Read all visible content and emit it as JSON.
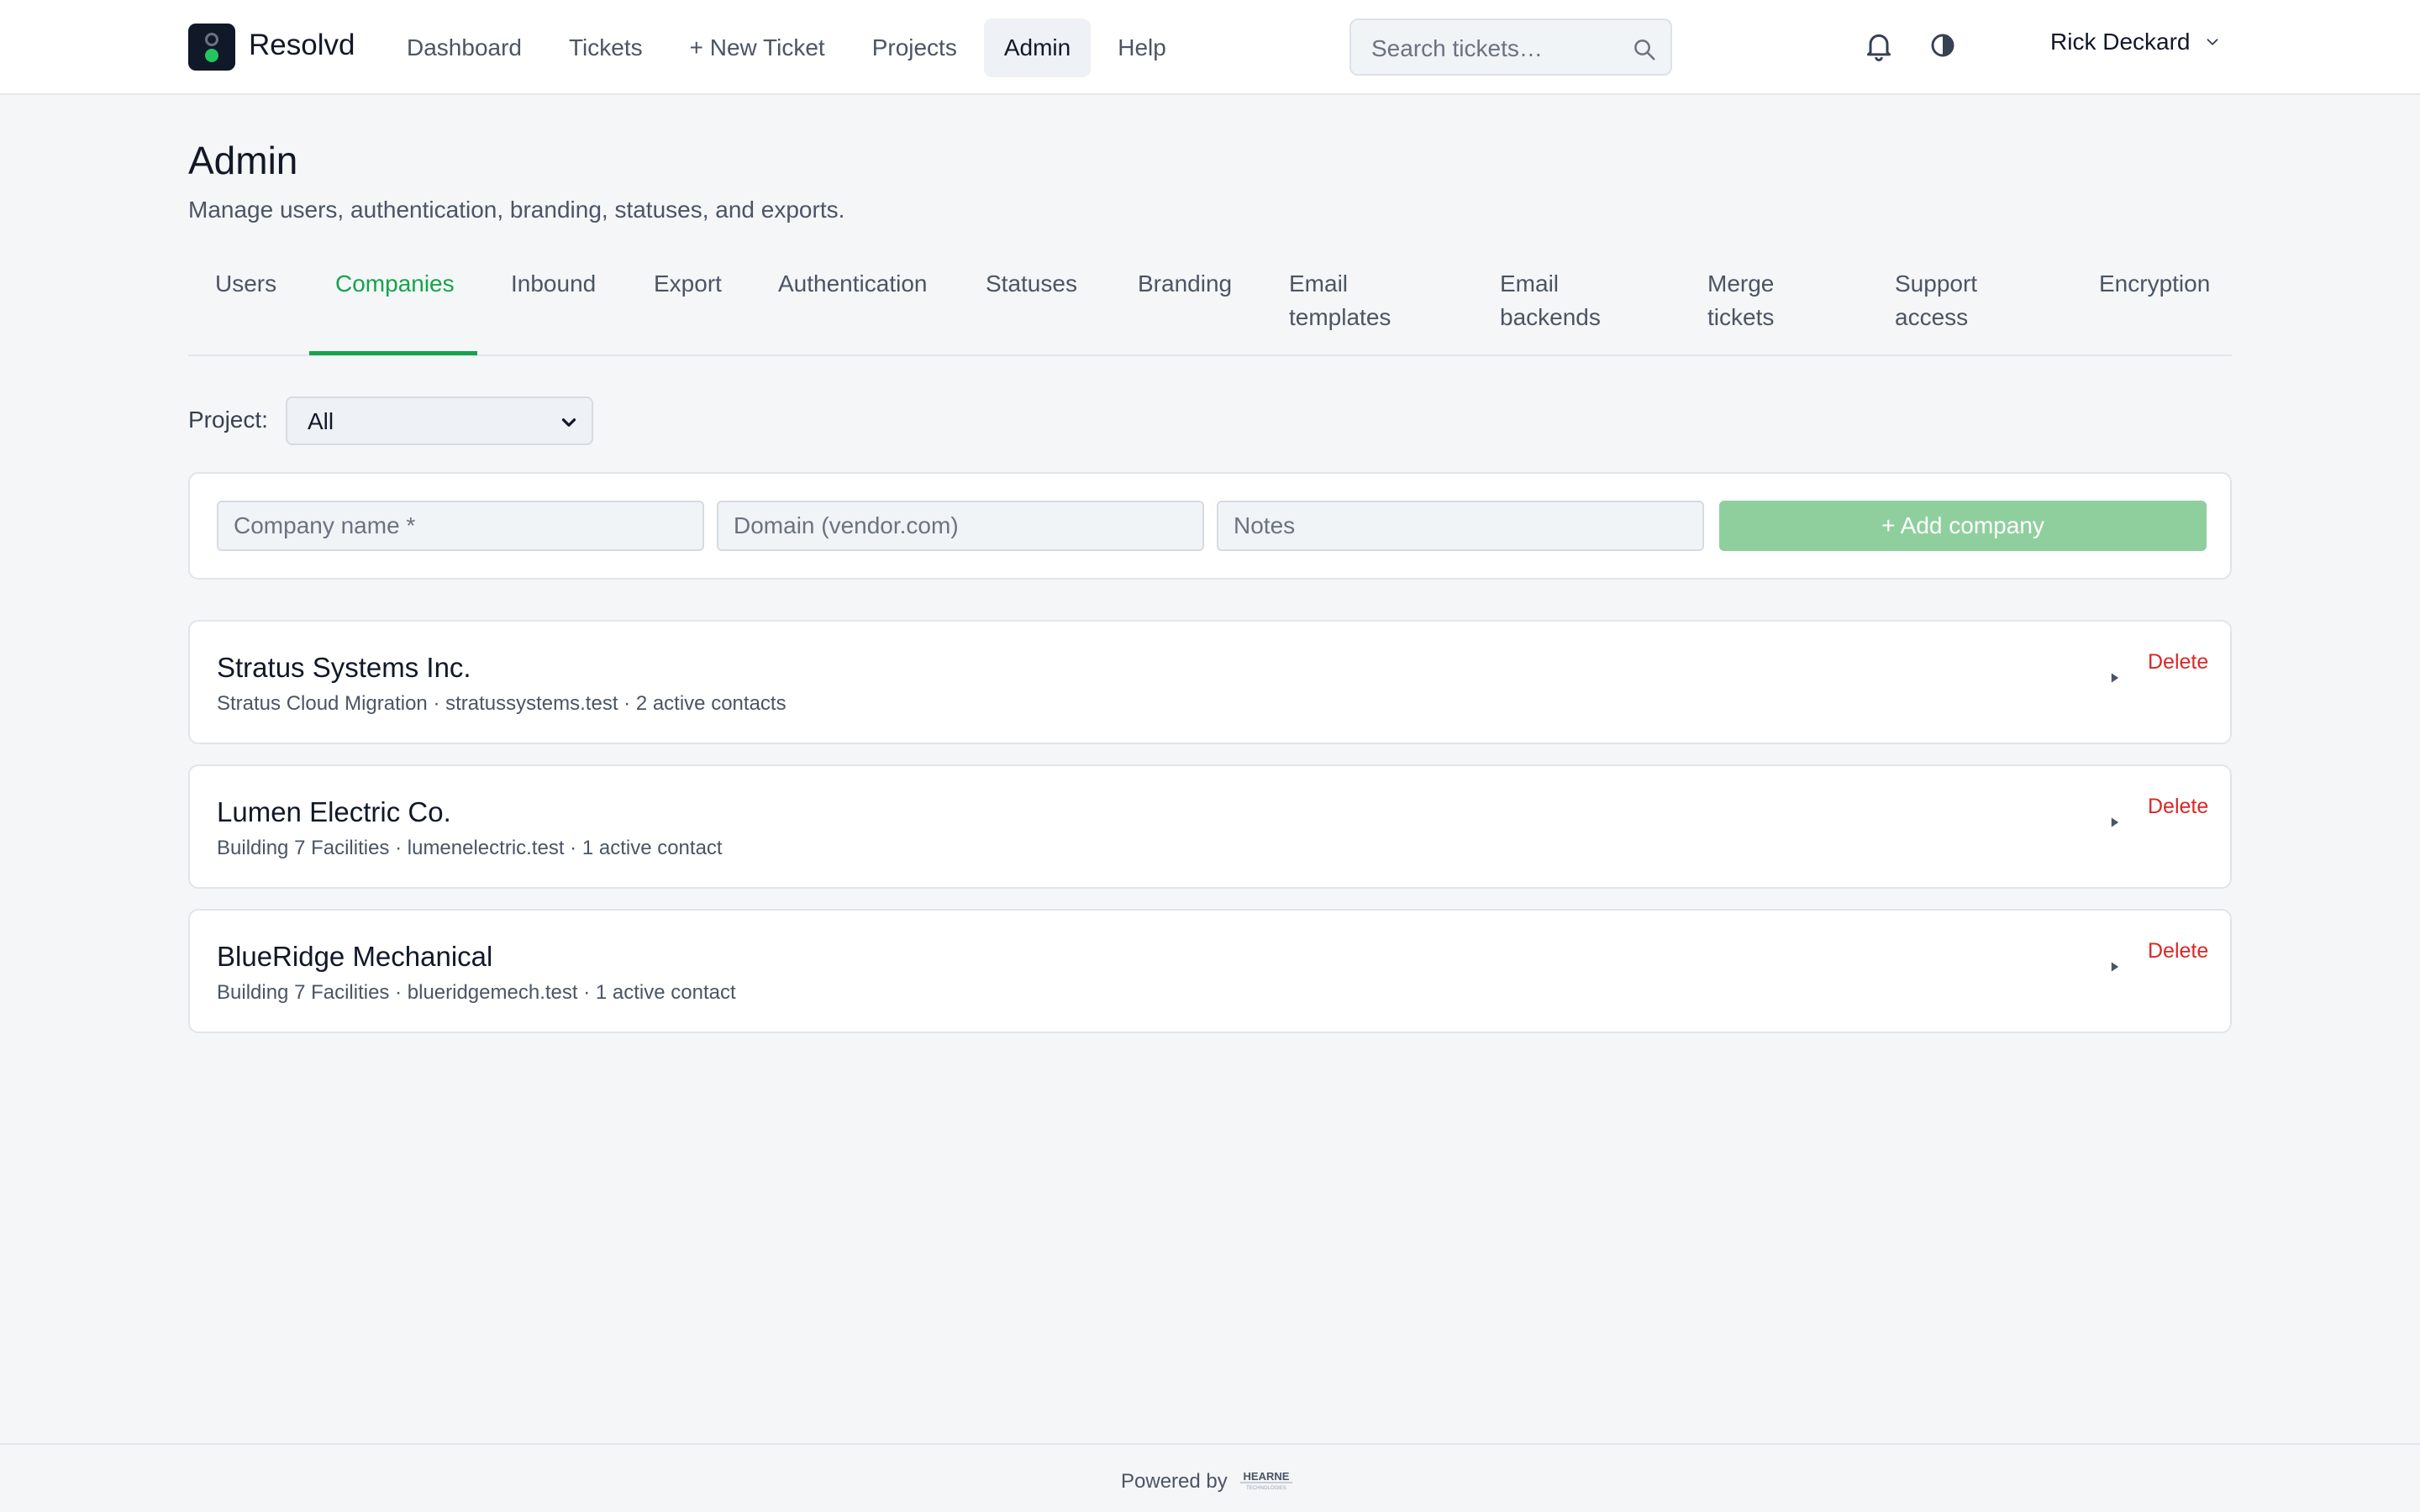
{
  "app": {
    "brand": "Resolvd"
  },
  "nav": {
    "items": [
      {
        "label": "Dashboard"
      },
      {
        "label": "Tickets"
      },
      {
        "label": "+ New Ticket"
      },
      {
        "label": "Projects"
      },
      {
        "label": "Admin",
        "active": true
      },
      {
        "label": "Help"
      }
    ]
  },
  "search": {
    "placeholder": "Search tickets…"
  },
  "user": {
    "name": "Rick Deckard"
  },
  "page": {
    "title": "Admin",
    "subtitle": "Manage users, authentication, branding, statuses, and exports."
  },
  "tabs": [
    {
      "label": "Users"
    },
    {
      "label": "Companies",
      "active": true
    },
    {
      "label": "Inbound"
    },
    {
      "label": "Export"
    },
    {
      "label": "Authentication"
    },
    {
      "label": "Statuses"
    },
    {
      "label": "Branding"
    },
    {
      "label": "Email\ntemplates"
    },
    {
      "label": "Email\nbackends"
    },
    {
      "label": "Merge\ntickets"
    },
    {
      "label": "Support\naccess"
    },
    {
      "label": "Encryption"
    }
  ],
  "filter": {
    "label": "Project:",
    "selected": "All"
  },
  "form": {
    "name_placeholder": "Company name *",
    "domain_placeholder": "Domain (vendor.com)",
    "notes_placeholder": "Notes",
    "add_label": "+ Add company"
  },
  "companies": [
    {
      "name": "Stratus Systems Inc.",
      "meta": "Stratus Cloud Migration · stratussystems.test · 2 active contacts",
      "delete_label": "Delete"
    },
    {
      "name": "Lumen Electric Co.",
      "meta": "Building 7 Facilities · lumenelectric.test · 1 active contact",
      "delete_label": "Delete"
    },
    {
      "name": "BlueRidge Mechanical",
      "meta": "Building 7 Facilities · blueridgemech.test · 1 active contact",
      "delete_label": "Delete"
    }
  ],
  "footer": {
    "powered_by": "Powered by",
    "logo_text": "HEARNE",
    "logo_subtext": "TECHNOLOGIES"
  },
  "colors": {
    "accent": "#16a34a",
    "danger": "#dc2626",
    "add_button": "#8fcf9e"
  }
}
